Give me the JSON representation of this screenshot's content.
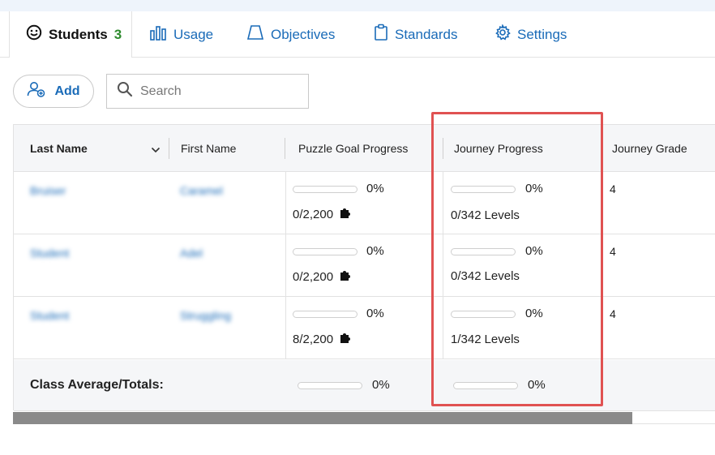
{
  "tabs": [
    {
      "label": "Students",
      "count": "3",
      "icon": "smiley-icon",
      "active": true
    },
    {
      "label": "Usage",
      "icon": "bar-chart-icon"
    },
    {
      "label": "Objectives",
      "icon": "trapezoid-icon"
    },
    {
      "label": "Standards",
      "icon": "clipboard-icon"
    },
    {
      "label": "Settings",
      "icon": "gear-icon"
    }
  ],
  "toolbar": {
    "add_label": "Add",
    "search_placeholder": "Search"
  },
  "table": {
    "columns": [
      "Last Name",
      "First Name",
      "Puzzle Goal Progress",
      "Journey Progress",
      "Journey Grade"
    ],
    "rows": [
      {
        "last_name": "Bruiser",
        "first_name": "Caramel",
        "puzzle_progress": 0,
        "puzzle_pct": "0%",
        "puzzle_count": "0/2,200",
        "journey_progress": 0,
        "journey_pct": "0%",
        "journey_count": "0/342",
        "journey_unit": "Levels",
        "grade": "4"
      },
      {
        "last_name": "Student",
        "first_name": "Adel",
        "puzzle_progress": 0,
        "puzzle_pct": "0%",
        "puzzle_count": "0/2,200",
        "journey_progress": 0,
        "journey_pct": "0%",
        "journey_count": "0/342",
        "journey_unit": "Levels",
        "grade": "4"
      },
      {
        "last_name": "Student",
        "first_name": "Struggling",
        "puzzle_progress": 0,
        "puzzle_pct": "0%",
        "puzzle_count": "8/2,200",
        "journey_progress": 0,
        "journey_pct": "0%",
        "journey_count": "1/342",
        "journey_unit": "Levels",
        "grade": "4"
      }
    ],
    "footer": {
      "label": "Class Average/Totals:",
      "puzzle_progress": 0,
      "puzzle_pct": "0%",
      "journey_progress": 0,
      "journey_pct": "0%"
    }
  },
  "colors": {
    "accent": "#1a6bb8",
    "count_green": "#2e8b2e",
    "highlight_border": "#e05252"
  }
}
